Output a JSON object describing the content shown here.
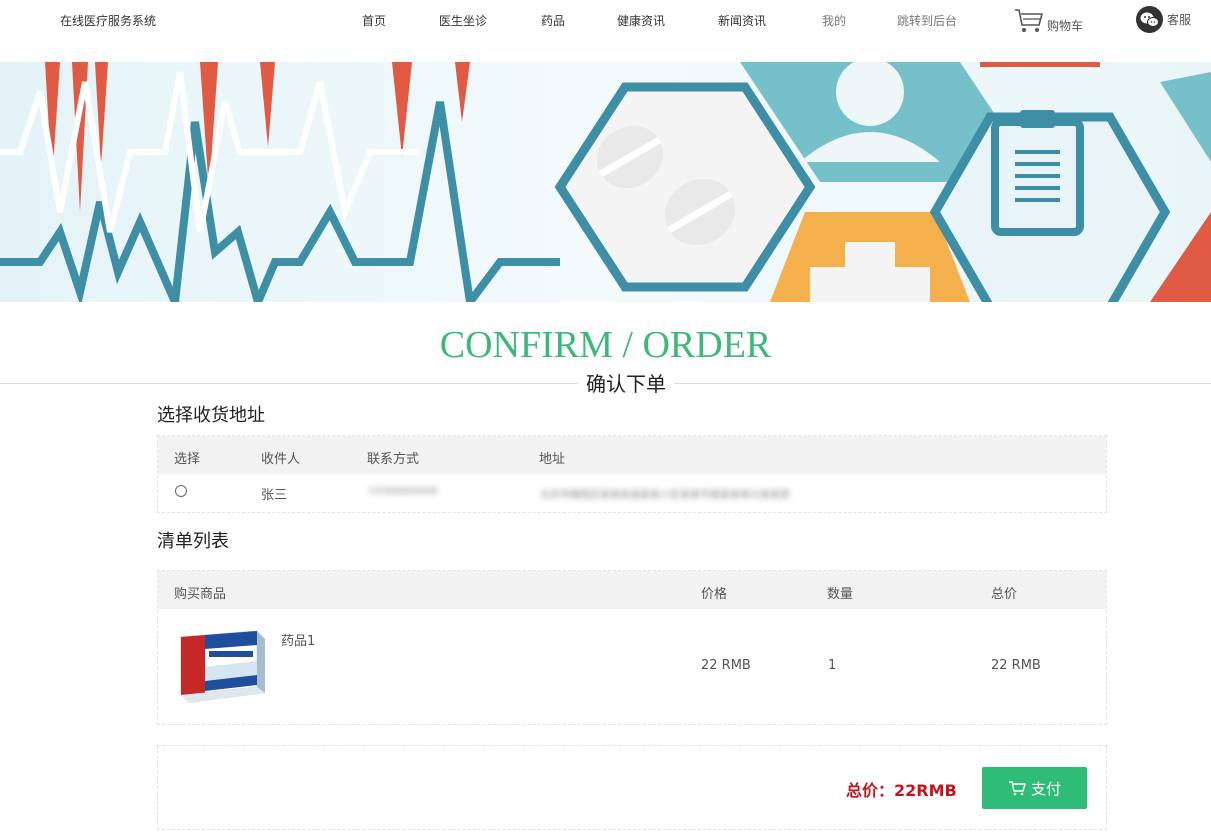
{
  "header": {
    "site_title": "在线医疗服务系统",
    "nav": [
      {
        "label": "首页"
      },
      {
        "label": "医生坐诊"
      },
      {
        "label": "药品"
      },
      {
        "label": "健康资讯"
      },
      {
        "label": "新闻资讯"
      },
      {
        "label": "我的"
      },
      {
        "label": "跳转到后台"
      }
    ],
    "cart_label": "购物车",
    "service_label": "客服"
  },
  "page": {
    "title_en": "CONFIRM / ORDER",
    "title_zh": "确认下单"
  },
  "address": {
    "heading": "选择收货地址",
    "columns": [
      "选择",
      "收件人",
      "联系方式",
      "地址"
    ],
    "rows": [
      {
        "recipient": "张三",
        "phone": "15300000000",
        "address": "北京市朝阳区某某街道某某小区某某号楼某某单元某某室"
      }
    ]
  },
  "order": {
    "heading": "清单列表",
    "columns": [
      "购买商品",
      "价格",
      "数量",
      "总价"
    ],
    "items": [
      {
        "name": "药品1",
        "price": "22 RMB",
        "quantity": "1",
        "total": "22 RMB",
        "image_icon": "medicine-box-icon"
      }
    ]
  },
  "summary": {
    "total_text": "总价：22RMB",
    "pay_label": "支付"
  },
  "colors": {
    "accent_green": "#2ebc76",
    "title_green": "#3cb878",
    "total_red": "#c3161c"
  }
}
